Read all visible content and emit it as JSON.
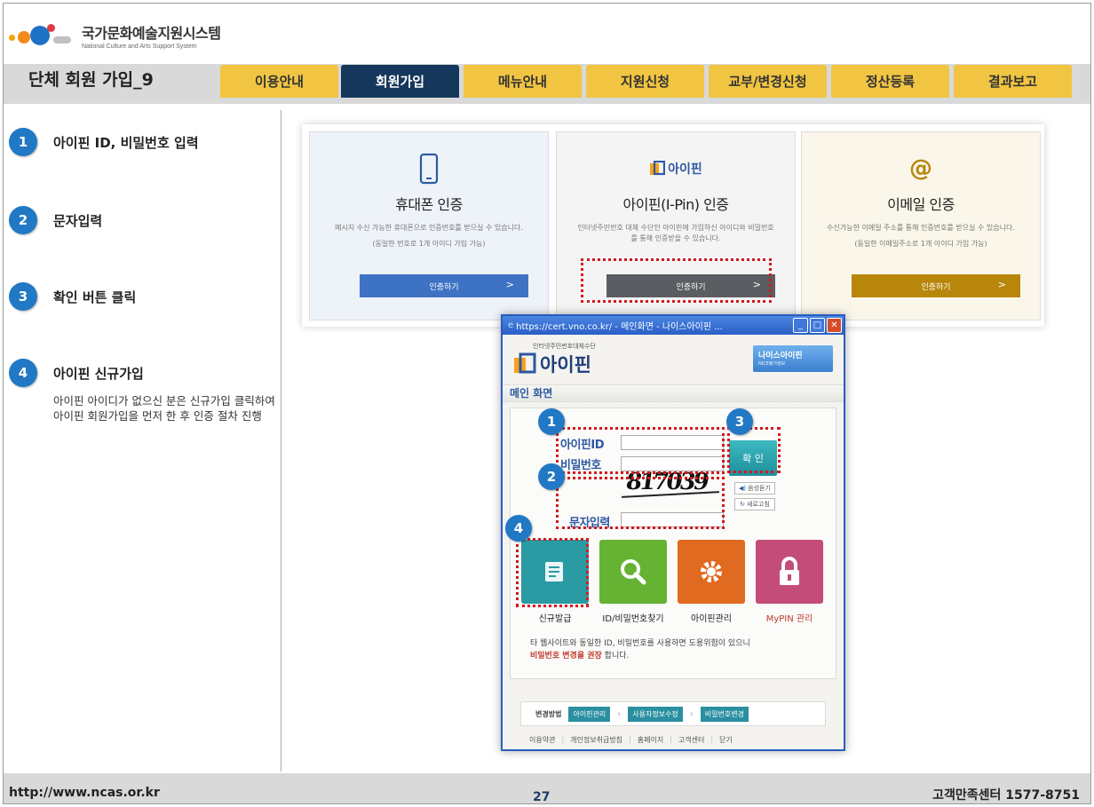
{
  "logo": {
    "title_ko": "국가문화예술지원시스템",
    "title_en": "National Culture and Arts Support System"
  },
  "page_title": "단체 회원 가입_9",
  "tabs": [
    {
      "label": "이용안내",
      "active": false
    },
    {
      "label": "회원가입",
      "active": true
    },
    {
      "label": "메뉴안내",
      "active": false
    },
    {
      "label": "지원신청",
      "active": false
    },
    {
      "label": "교부/변경신청",
      "active": false
    },
    {
      "label": "정산등록",
      "active": false
    },
    {
      "label": "결과보고",
      "active": false
    }
  ],
  "steps": [
    {
      "num": "1",
      "label": "아이핀 ID, 비밀번호 입력"
    },
    {
      "num": "2",
      "label": "문자입력"
    },
    {
      "num": "3",
      "label": "확인 버튼 클릭"
    },
    {
      "num": "4",
      "label": "아이핀 신규가입"
    }
  ],
  "step4_desc": "아이핀 아이디가 없으신 분은 신규가입 클릭하여 아이핀 회원가입을 먼저 한 후 인증 절차 진행",
  "cards": [
    {
      "title": "휴대폰 인증",
      "desc": "메시지 수신 가능한 휴대폰으로 인증번호를 받으실 수 있습니다.",
      "note": "(동일한 번호로 1개 아이디 가입 가능)",
      "button": "인증하기",
      "chevron": ">",
      "icon": "mobile-phone-icon",
      "bg": "#eef3f9",
      "btn_color": "#3e73c4"
    },
    {
      "title": "아이핀(I-Pin) 인증",
      "desc": "인터넷주민번호 대체 수단인 아이핀에 가입하신 아이디와 비밀번호를 통해 인증받을 수 있습니다.",
      "note": "",
      "button": "인증하기",
      "chevron": ">",
      "icon": "ipin-logo-icon",
      "icon_text": "아이핀",
      "bg": "#f4f4f4",
      "btn_color": "#5a5d61"
    },
    {
      "title": "이메일 인증",
      "desc": "수신가능한 이메일 주소를 통해 인증번호를 받으실 수 있습니다.",
      "note": "(동일한 이메일주소로 1개 아이디 가입 가능)",
      "button": "인증하기",
      "chevron": ">",
      "icon": "at-sign-icon",
      "icon_text": "@",
      "bg": "#faf6ea",
      "btn_color": "#b8860b"
    }
  ],
  "popup": {
    "title": "https://cert.vno.co.kr/ - 메인화면 - 나이스아이핀 ...",
    "small_caption": "인터넷주민번호대체수단",
    "logo_text": "아이핀",
    "badge": "나이스아이핀",
    "badge_sub": "NICE평가정보",
    "section_title": "메인 화면",
    "id_label": "아이핀ID",
    "pw_label": "비밀번호",
    "captcha_label": "문자입력",
    "captcha_text": "817039",
    "ok_button": "확 인",
    "listen_button": "음성듣기",
    "refresh_button": "새로고침",
    "tiles": [
      {
        "label": "신규발급",
        "icon": "document-write-icon",
        "color": "#2a9aa3",
        "label_color": "#222"
      },
      {
        "label": "ID/비밀번호찾기",
        "icon": "magnifier-icon",
        "color": "#66b233",
        "label_color": "#222"
      },
      {
        "label": "아이핀관리",
        "icon": "gear-icon",
        "color": "#e06a1f",
        "label_color": "#222"
      },
      {
        "label": "MyPIN 관리",
        "icon": "lock-icon",
        "color": "#c34d78",
        "label_color": "#c0392b"
      }
    ],
    "notice": "타 웹사이트와 동일한 ID, 비밀번호를 사용하면 도용위험이 있으니",
    "notice_strong": "비밀번호 변경을 권장",
    "notice_tail": "합니다.",
    "change_label": "변경방법",
    "change_steps": [
      "아이핀관리",
      "사용자정보수정",
      "비밀번호변경"
    ],
    "footer_links": [
      "이용약관",
      "개인정보취급방침",
      "홈페이지",
      "고객센터",
      "닫기"
    ]
  },
  "footer": {
    "url": "http://www.ncas.or.kr",
    "page_number": "27",
    "support": "고객만족센터 1577-8751"
  }
}
